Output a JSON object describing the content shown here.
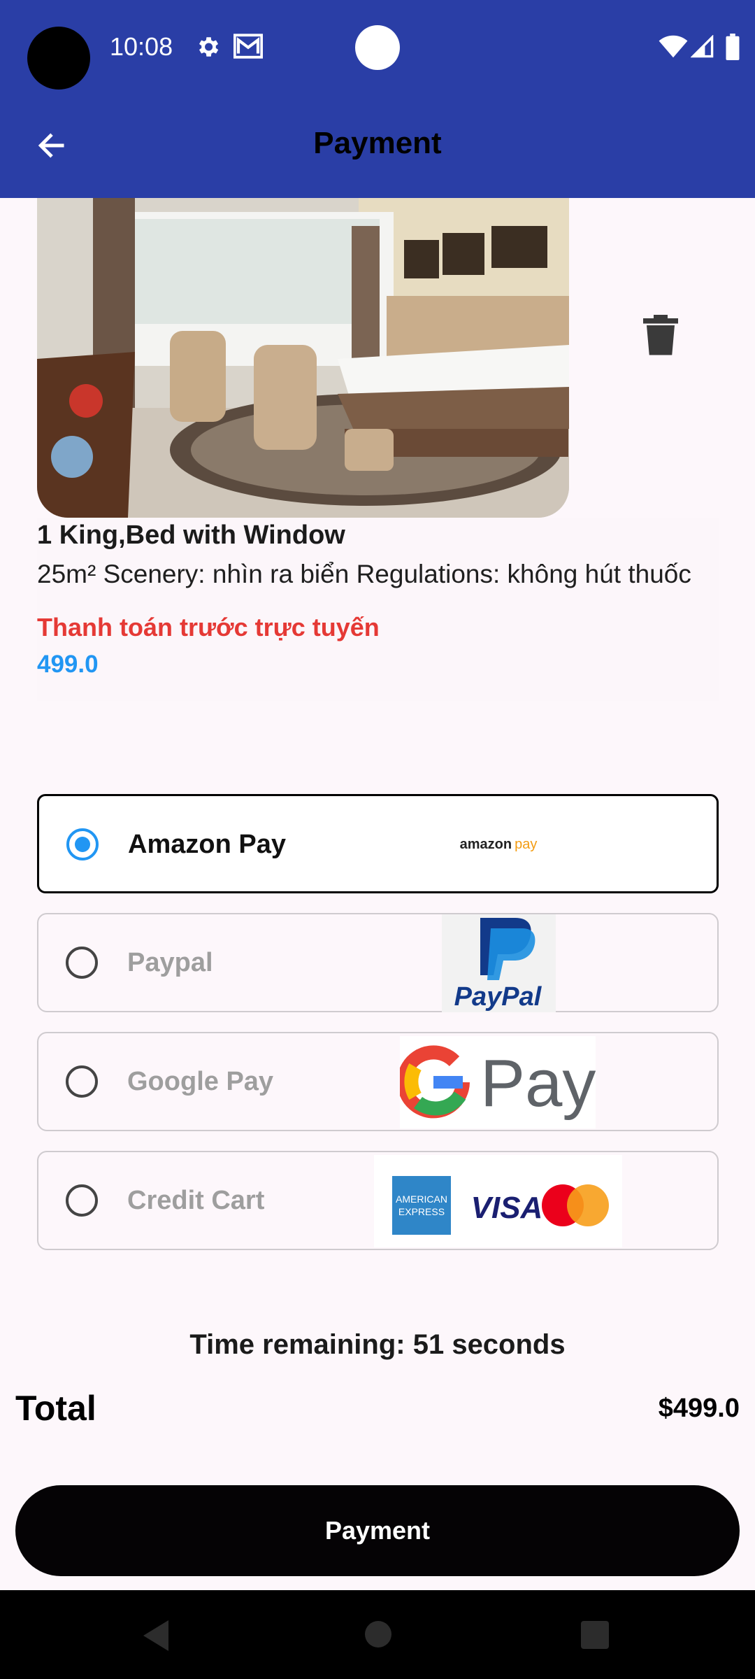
{
  "status_bar": {
    "time": "10:08"
  },
  "app_bar": {
    "title": "Payment"
  },
  "room": {
    "name": "1 King,Bed with Window",
    "description": "25m² Scenery: nhìn ra biển Regulations: không hút thuốc",
    "payment_note": "Thanh toán trước trực tuyến",
    "price": "499.0"
  },
  "payment_methods": [
    {
      "label": "Amazon Pay",
      "selected": true,
      "logo_text": "amazon pay"
    },
    {
      "label": "Paypal",
      "selected": false,
      "logo_text": "PayPal"
    },
    {
      "label": "Google Pay",
      "selected": false,
      "logo_text": "Pay"
    },
    {
      "label": "Credit Cart",
      "selected": false,
      "logo_text": "VISA"
    }
  ],
  "timer": {
    "text": "Time remaining: 51 seconds"
  },
  "total": {
    "label": "Total",
    "value": "$499.0"
  },
  "actions": {
    "payment_button": "Payment"
  },
  "colors": {
    "app_bar": "#2a3ea6",
    "accent_blue": "#2196f3",
    "note_red": "#e53935",
    "button": "#050305"
  }
}
